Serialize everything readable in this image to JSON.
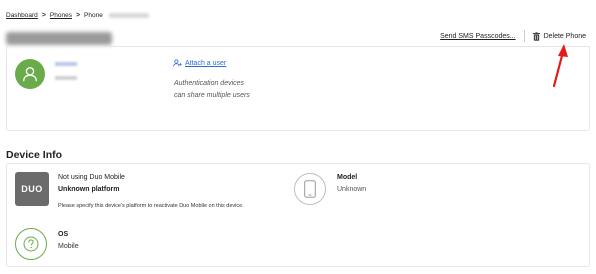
{
  "breadcrumb": {
    "items": [
      "Dashboard",
      "Phones",
      "Phone"
    ],
    "separator": ">"
  },
  "header": {
    "title": "425-647-0195",
    "sms_label": "Send SMS Passcodes...",
    "delete_label": "Delete Phone"
  },
  "user_card": {
    "attach_label": "Attach a user",
    "auth_note": "Authentication devices can share multiple users"
  },
  "device_info": {
    "section_title": "Device Info",
    "duo_logo_text": "DUO",
    "not_using": "Not using Duo Mobile",
    "platform": "Unknown platform",
    "specify_note": "Please specify this device's platform to reactivate Duo Mobile on this device.",
    "model_label": "Model",
    "model_value": "Unknown",
    "os_label": "OS",
    "os_value": "Mobile"
  },
  "colors": {
    "avatar_green": "#6aab4b",
    "link_blue": "#2b6bd6",
    "arrow_red": "#e21b1b",
    "duo_gray": "#6b6b6b"
  },
  "icons": {
    "avatar": "user-silhouette-icon",
    "attach": "add-user-icon",
    "delete": "trash-icon",
    "model": "phone-icon",
    "os": "question-circle-icon"
  }
}
